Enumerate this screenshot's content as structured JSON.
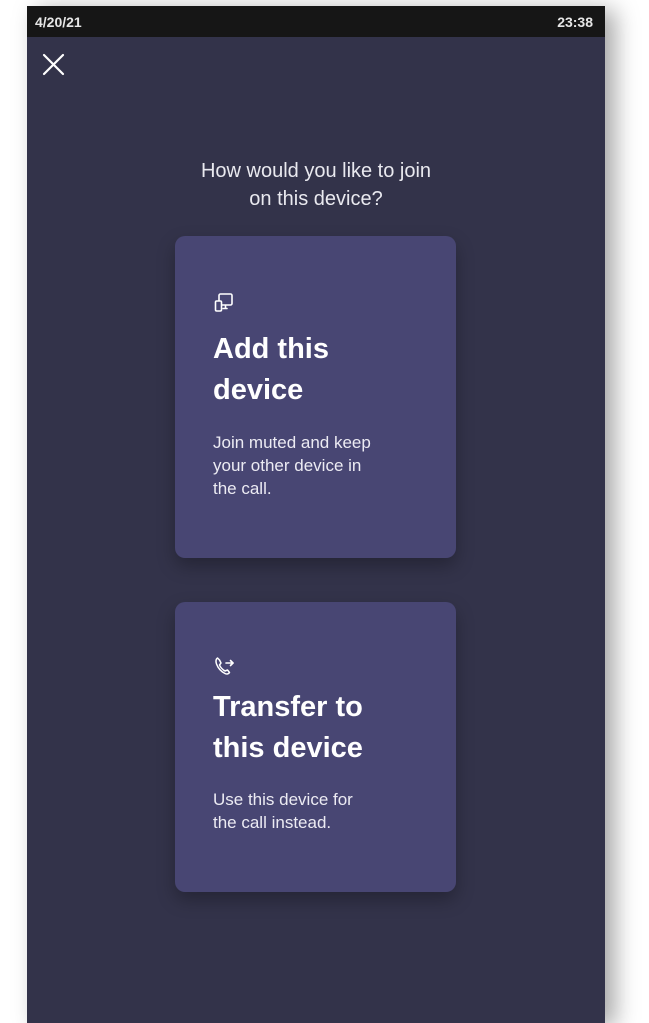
{
  "status_bar": {
    "date": "4/20/21",
    "time": "23:38"
  },
  "close_button": {
    "icon": "close-icon"
  },
  "prompt": {
    "line1": "How would you like to join",
    "line2": "on this device?"
  },
  "options": [
    {
      "icon": "add-device-icon",
      "title_line1": "Add this",
      "title_line2": "device",
      "desc_line1": "Join muted and keep",
      "desc_line2": "your other device in",
      "desc_line3": "the call."
    },
    {
      "icon": "transfer-call-icon",
      "title_line1": "Transfer to",
      "title_line2": "this device",
      "desc_line1": "Use this device for",
      "desc_line2": "the call instead."
    }
  ],
  "colors": {
    "background": "#33334a",
    "card": "#484673",
    "status_bar": "#161616",
    "text": "#ffffff"
  }
}
